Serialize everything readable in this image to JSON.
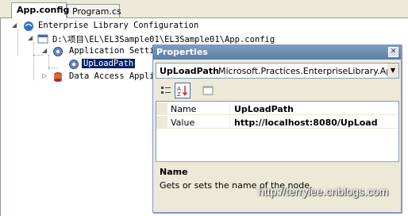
{
  "tabs": [
    {
      "label": "App.config",
      "active": true
    },
    {
      "label": "Program.cs",
      "active": false
    }
  ],
  "tree": {
    "root": "Enterprise Library Configuration",
    "file": "D:\\项目\\EL\\EL3Sample01\\EL3Sample01\\App.config",
    "app_settings": "Application Settings",
    "setting": "UpLoadPath",
    "data_access": "Data Access Application Block"
  },
  "properties": {
    "title": "Properties",
    "close_label": "✕",
    "object_name": "UpLoadPath",
    "object_type": "Microsoft.Practices.EnterpriseLibrary.AppSettings",
    "rows": [
      {
        "key": "Name",
        "value": "UpLoadPath"
      },
      {
        "key": "Value",
        "value": "http://localhost:8080/UpLoad"
      }
    ],
    "description_title": "Name",
    "description_text": "Gets or sets the name of the node."
  },
  "watermark": "http://terrylee.cnblogs.com"
}
